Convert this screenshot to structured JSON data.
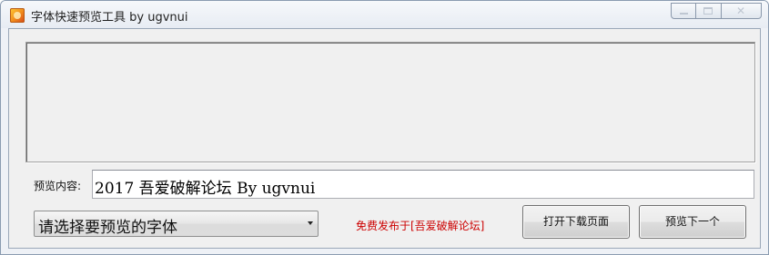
{
  "window": {
    "title": "字体快速预览工具 by ugvnui",
    "icon": "app-icon"
  },
  "caption": {
    "minimize_icon": "minimize-icon",
    "maximize_icon": "maximize-icon",
    "close_icon": "close-icon",
    "close_glyph": "✕"
  },
  "preview": {
    "label": "预览内容:",
    "text": "2017 吾爱破解论坛 By ugvnui"
  },
  "font_select": {
    "selected": "请选择要预览的字体"
  },
  "notice": {
    "text": "免费发布于[吾爱破解论坛]",
    "color": "#cc0000"
  },
  "buttons": {
    "open_download": "打开下载页面",
    "preview_next": "预览下一个"
  }
}
